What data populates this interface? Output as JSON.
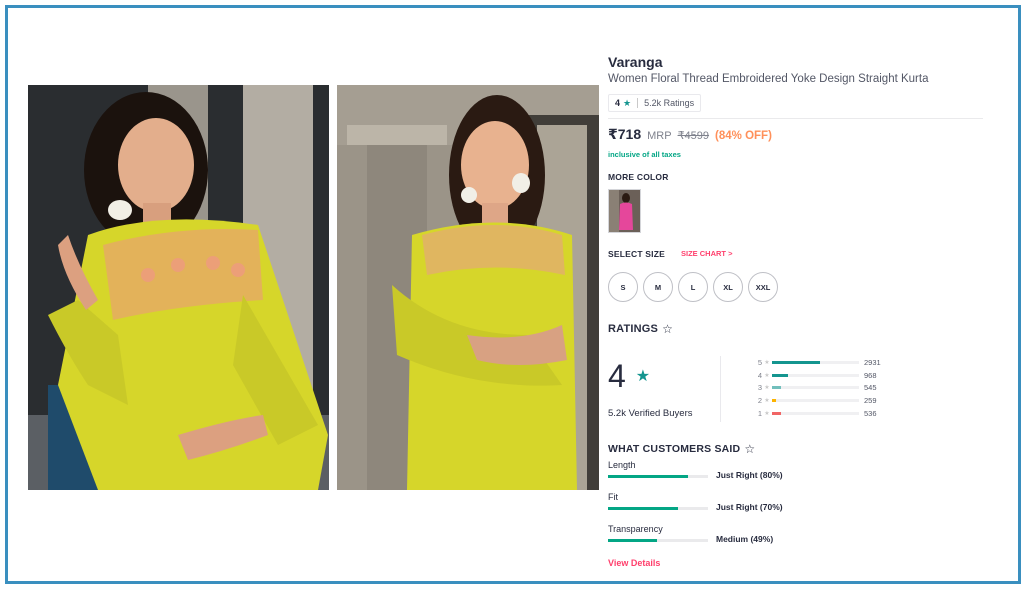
{
  "product": {
    "brand": "Varanga",
    "title": "Women Floral Thread Embroidered Yoke Design Straight Kurta",
    "rating_value": "4",
    "rating_count": "5.2k Ratings",
    "price": "₹718",
    "mrp_label": "MRP",
    "mrp": "₹4599",
    "discount": "(84% OFF)",
    "tax_note": "inclusive of all taxes"
  },
  "colors": {
    "heading": "MORE COLOR",
    "accent": "#14958f",
    "pink": "#ff3f6c",
    "discount": "#ff905a",
    "kurta": "#d6d62a"
  },
  "size": {
    "heading": "SELECT SIZE",
    "chart_link": "SIZE CHART >",
    "options": [
      "S",
      "M",
      "L",
      "XL",
      "XXL"
    ]
  },
  "ratings": {
    "heading": "RATINGS",
    "average": "4",
    "verified": "5.2k Verified Buyers",
    "distribution": [
      {
        "star": "5",
        "count": "2931",
        "fraction": 0.55,
        "color": "#14958f"
      },
      {
        "star": "4",
        "count": "968",
        "fraction": 0.18,
        "color": "#14958f"
      },
      {
        "star": "3",
        "count": "545",
        "fraction": 0.1,
        "color": "#72bfbc"
      },
      {
        "star": "2",
        "count": "259",
        "fraction": 0.05,
        "color": "#fcb301"
      },
      {
        "star": "1",
        "count": "536",
        "fraction": 0.1,
        "color": "#f16565"
      }
    ]
  },
  "customers_said": {
    "heading": "WHAT CUSTOMERS SAID",
    "items": [
      {
        "label": "Length",
        "value": "Just Right (80%)",
        "percent": 80
      },
      {
        "label": "Fit",
        "value": "Just Right (70%)",
        "percent": 70
      },
      {
        "label": "Transparency",
        "value": "Medium (49%)",
        "percent": 49
      }
    ],
    "view_details": "View Details"
  }
}
